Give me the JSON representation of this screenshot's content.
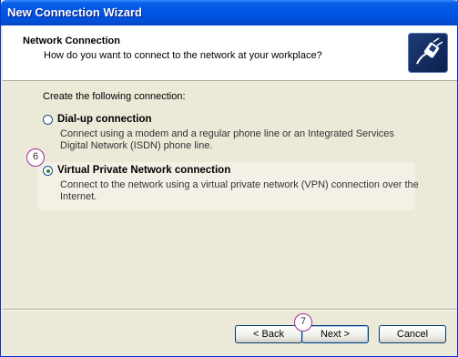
{
  "window": {
    "title": "New Connection Wizard"
  },
  "header": {
    "title": "Network Connection",
    "subtitle": "How do you want to connect to the network at your workplace?"
  },
  "body": {
    "prompt": "Create the following connection:",
    "options": [
      {
        "label": "Dial-up connection",
        "description": "Connect using a modem and a regular phone line or an Integrated Services Digital Network (ISDN) phone line.",
        "selected": false
      },
      {
        "label": "Virtual Private Network connection",
        "description": "Connect to the network using a virtual private network (VPN) connection over the Internet.",
        "selected": true
      }
    ]
  },
  "markers": {
    "step6": "6",
    "step7": "7"
  },
  "buttons": {
    "back": "< Back",
    "next": "Next >",
    "cancel": "Cancel"
  },
  "icons": {
    "header": "network-plug-icon"
  }
}
